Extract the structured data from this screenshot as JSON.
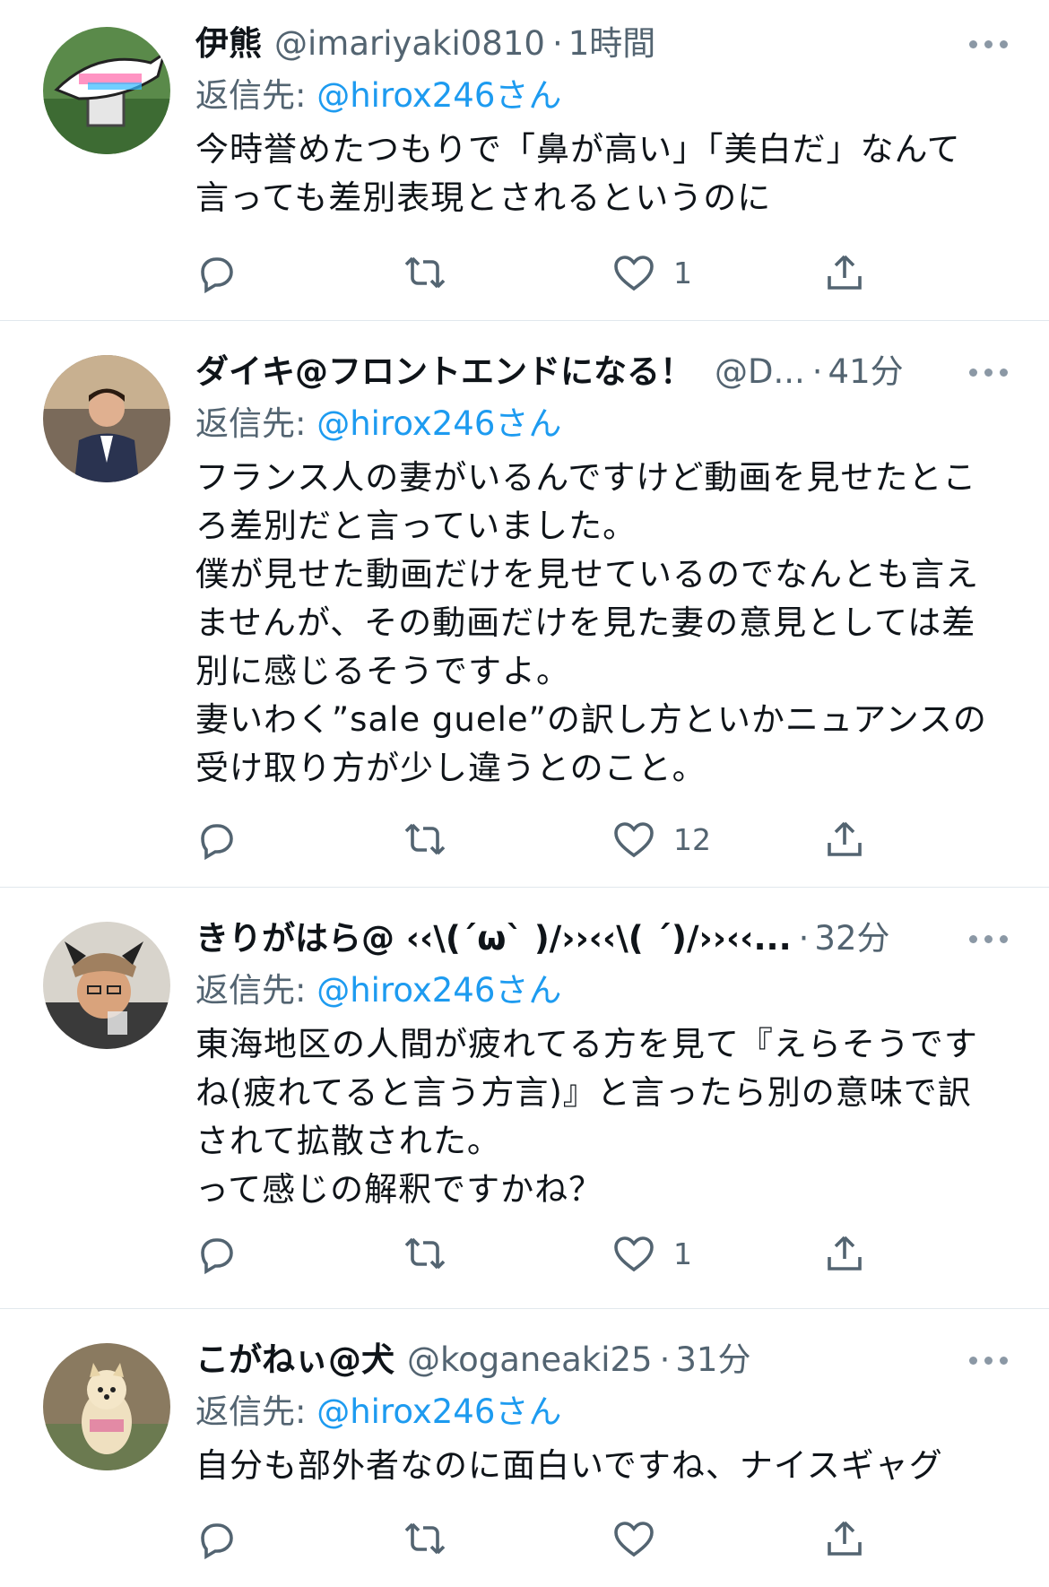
{
  "tweets": [
    {
      "name": "伊熊",
      "handle": "@imariyaki0810",
      "time": "1時間",
      "reply_prefix": "返信先: ",
      "reply_mention": "@hirox246さん",
      "body": "今時誉めたつもりで「鼻が高い」「美白だ」なんて\n言っても差別表現とされるというのに",
      "like_count": "1",
      "avatar": "shark-train-avatar"
    },
    {
      "name": "ダイキ@フロントエンドになる！",
      "handle": "@D...",
      "time": "41分",
      "reply_prefix": "返信先: ",
      "reply_mention": "@hirox246さん",
      "body": "フランス人の妻がいるんですけど動画を見せたとこ\nろ差別だと言っていました。\n僕が見せた動画だけを見せているのでなんとも言え\nませんが、その動画だけを見た妻の意見としては差\n別に感じるそうですよ。\n妻いわく”sale guele”の訳し方といかニュアンスの\n受け取り方が少し違うとのこと。",
      "like_count": "12",
      "avatar": "man-in-suit-avatar"
    },
    {
      "name": "きりがはら@ ‹‹\\(´ω` )/››‹‹\\( ´)/››‹‹...",
      "handle": "",
      "time": "32分",
      "reply_prefix": "返信先: ",
      "reply_mention": "@hirox246さん",
      "body": "東海地区の人間が疲れてる方を見て『えらそうです\nね(疲れてると言う方言)』と言ったら別の意味で訳\nされて拡散された。\nって感じの解釈ですかね？",
      "like_count": "1",
      "avatar": "man-with-cat-ears-avatar"
    },
    {
      "name": "こがねぃ@犬",
      "handle": "@koganeaki25",
      "time": "31分",
      "reply_prefix": "返信先: ",
      "reply_mention": "@hirox246さん",
      "body": "自分も部外者なのに面白いですね、ナイスギャグ",
      "like_count": "",
      "avatar": "pomeranian-dog-avatar"
    }
  ],
  "colors": {
    "text": "#0f1419",
    "secondary": "#536471",
    "link": "#1d9bf0",
    "divider": "#e1e8ed"
  },
  "icons": [
    "reply-icon",
    "retweet-icon",
    "like-icon",
    "share-icon",
    "more-icon"
  ]
}
